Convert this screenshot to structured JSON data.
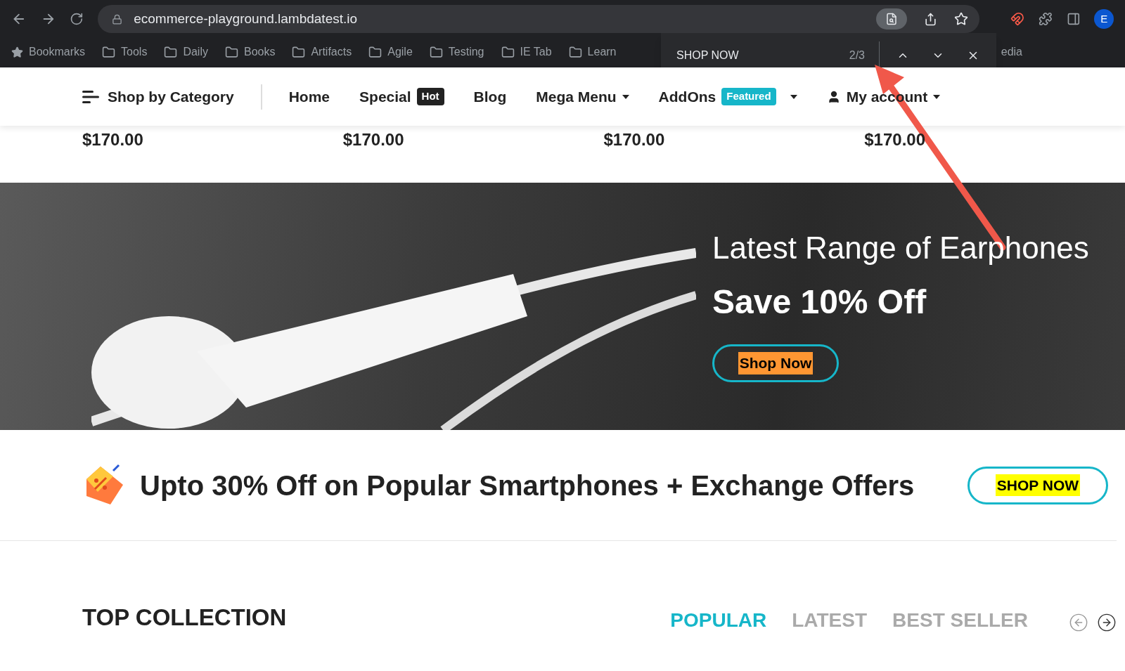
{
  "browser": {
    "url": "ecommerce-playground.lambdatest.io",
    "profile_initial": "E",
    "bookmarks": [
      {
        "label": "Bookmarks",
        "kind": "star"
      },
      {
        "label": "Tools",
        "kind": "folder"
      },
      {
        "label": "Daily",
        "kind": "folder"
      },
      {
        "label": "Books",
        "kind": "folder"
      },
      {
        "label": "Artifacts",
        "kind": "folder"
      },
      {
        "label": "Agile",
        "kind": "folder"
      },
      {
        "label": "Testing",
        "kind": "folder"
      },
      {
        "label": "IE Tab",
        "kind": "folder"
      },
      {
        "label": "Learn",
        "kind": "folder"
      }
    ],
    "bookmark_tail": "edia",
    "find_bar": {
      "query": "SHOP NOW",
      "count": "2/3"
    }
  },
  "nav": {
    "category": "Shop by Category",
    "items": [
      {
        "label": "Home",
        "dropdown": false
      },
      {
        "label": "Special",
        "badge": {
          "text": "Hot",
          "color": "#222222"
        },
        "dropdown": false
      },
      {
        "label": "Blog",
        "dropdown": false
      },
      {
        "label": "Mega Menu",
        "dropdown": true
      },
      {
        "label": "AddOns",
        "badge": {
          "text": "Featured",
          "color": "#16b6c9"
        },
        "dropdown": true
      },
      {
        "label": "My account",
        "dropdown": true,
        "user": true
      }
    ]
  },
  "prices": [
    "$170.00",
    "$170.00",
    "$170.00",
    "$170.00"
  ],
  "banner": {
    "title": "Latest Range of Earphones",
    "subtitle": "Save 10% Off",
    "button": {
      "label": "Shop Now",
      "current_match": true
    }
  },
  "promo": {
    "text": "Upto 30% Off on Popular Smartphones + Exchange Offers",
    "button": {
      "label": "SHOP NOW",
      "current_match": false
    }
  },
  "collection": {
    "title": "TOP COLLECTION",
    "tabs": [
      {
        "label": "POPULAR",
        "selected": true
      },
      {
        "label": "LATEST",
        "selected": false
      },
      {
        "label": "BEST SELLER",
        "selected": false
      }
    ]
  }
}
